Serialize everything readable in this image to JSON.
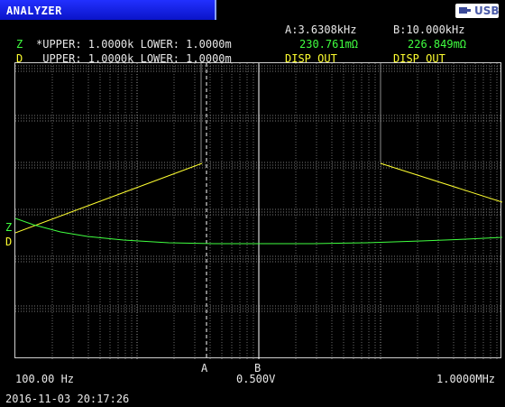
{
  "window": {
    "title": "ANALYZER",
    "usb_label": "USB",
    "usb_icon": "usb-plug-icon"
  },
  "header": {
    "marker_a_freq": "A:3.6308kHz",
    "marker_b_freq": "B:10.000kHz",
    "z_row": {
      "trace": "Z",
      "limits": "*UPPER: 1.0000k LOWER: 1.0000m",
      "a_value": "230.761mΩ",
      "b_value": "226.849mΩ"
    },
    "d_row": {
      "trace": "D",
      "limits": " UPPER: 1.0000k LOWER: 1.0000m",
      "a_value": "DISP OUT",
      "b_value": "DISP OUT"
    }
  },
  "plot": {
    "trace_labels": {
      "z": "Z",
      "d": "D"
    },
    "markers": {
      "a": "A",
      "b": "B"
    },
    "x_start": "100.00 Hz",
    "center_voltage": "0.500V",
    "x_end": "1.0000MHz"
  },
  "colors": {
    "z_trace": "#40ff40",
    "d_trace": "#ffff30",
    "title_bar": "#1a28e8"
  },
  "footer": {
    "timestamp": "2016-11-03 20:17:26"
  }
}
